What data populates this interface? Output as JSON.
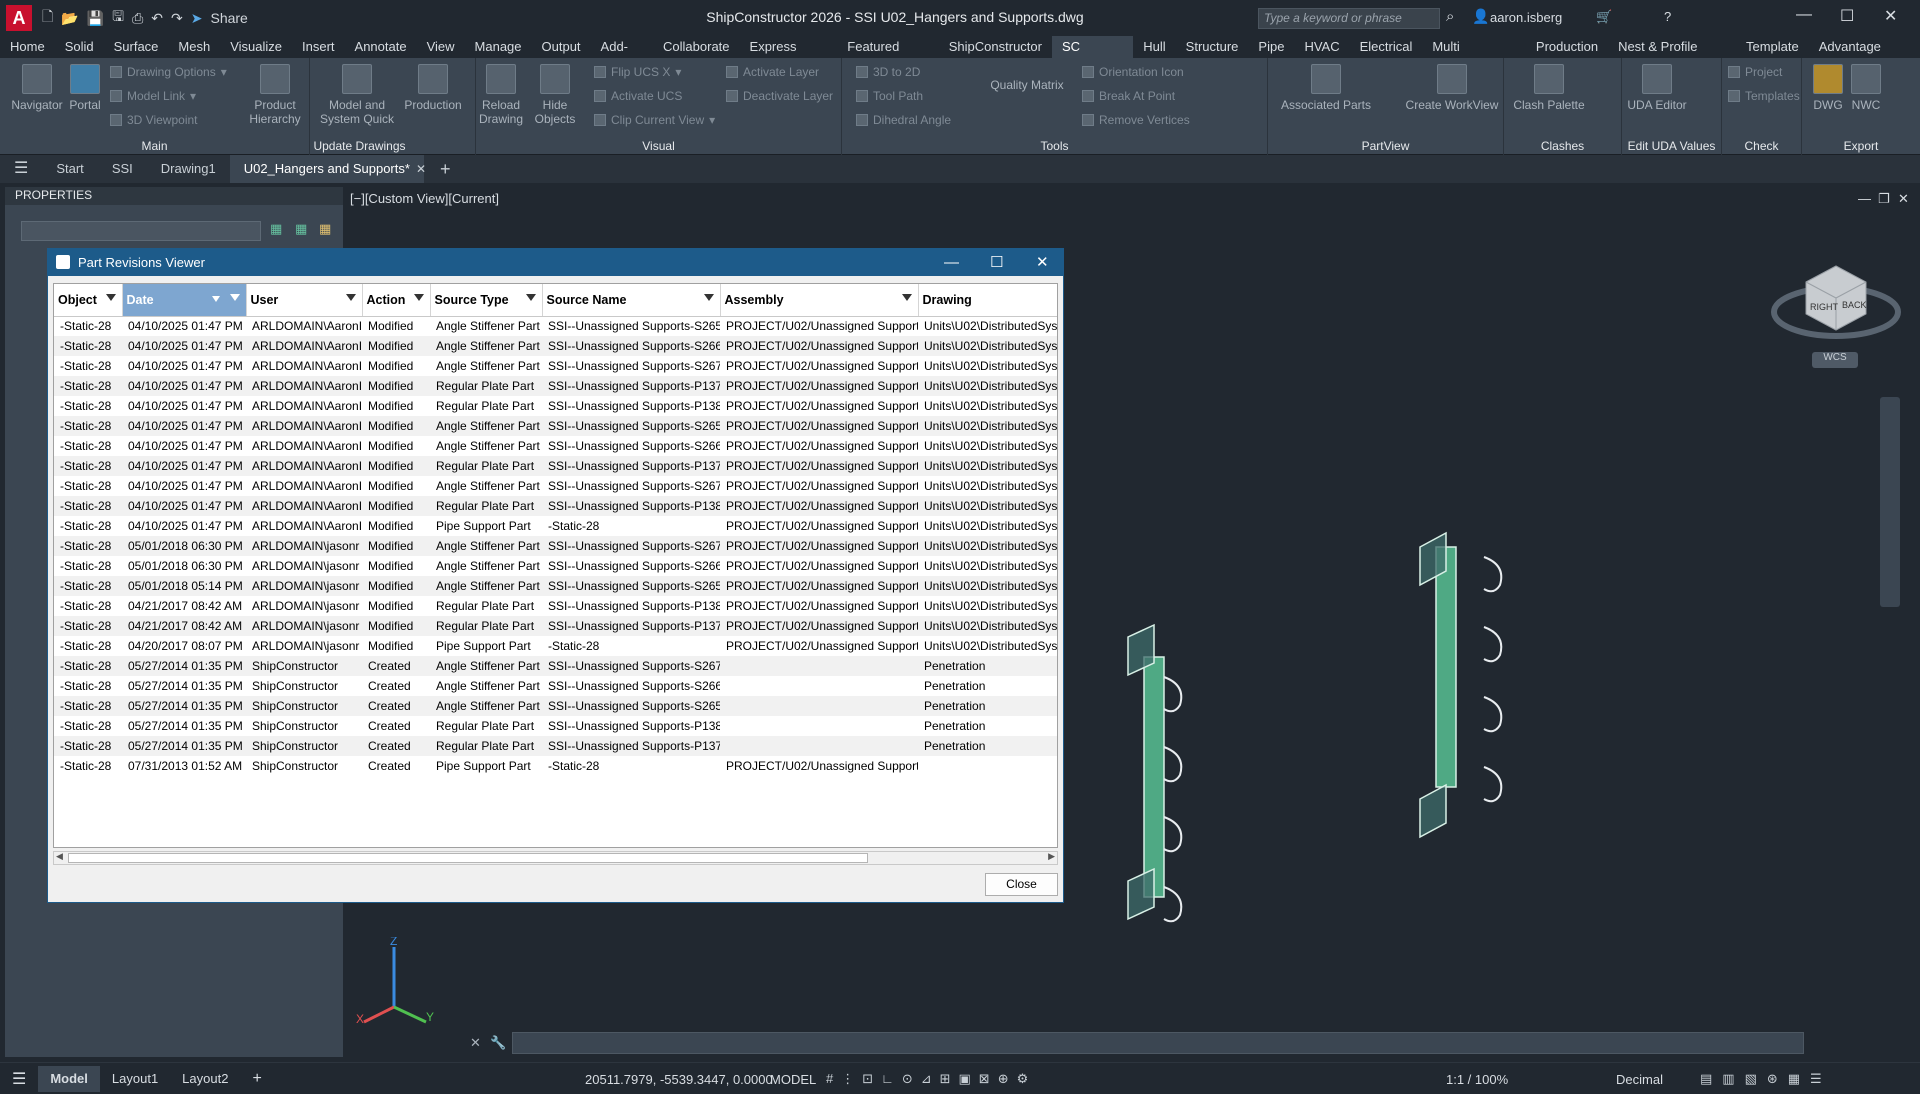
{
  "titlebar": {
    "title": "ShipConstructor 2026 - SSI   U02_Hangers and Supports.dwg",
    "share_label": "Share",
    "search_placeholder": "Type a keyword or phrase",
    "user": "aaron.isberg"
  },
  "ribbon_tabs": [
    "Home",
    "Solid",
    "Surface",
    "Mesh",
    "Visualize",
    "Insert",
    "Annotate",
    "View",
    "Manage",
    "Output",
    "Add-ins",
    "Collaborate",
    "Express Tools",
    "Featured Apps",
    "ShipConstructor",
    "SC Utilities",
    "Hull",
    "Structure",
    "Pipe",
    "HVAC",
    "Electrical",
    "Multi Discipline",
    "Production",
    "Nest & Profile Plots",
    "Template",
    "Advantage Pack"
  ],
  "active_ribbon_tab": "SC Utilities",
  "ribbon": {
    "main": {
      "title": "Main",
      "navigator": "Navigator",
      "portal": "Portal",
      "drawing_options": "Drawing Options",
      "model_link": "Model Link",
      "viewpoint": "3D Viewpoint"
    },
    "update": {
      "title": "Update Drawings",
      "product_hierarchy": "Product Hierarchy",
      "model_system": "Model and System Quick",
      "production": "Production"
    },
    "visual": {
      "title": "Visual",
      "reload": "Reload Drawing",
      "hide": "Hide Objects",
      "flip": "Flip UCS X",
      "activate_ucs": "Activate UCS",
      "clip": "Clip Current View",
      "activate_layer": "Activate Layer",
      "deactivate_layer": "Deactivate Layer"
    },
    "tools": {
      "title": "Tools",
      "to2d": "3D to 2D",
      "toolpath": "Tool Path",
      "dihedral": "Dihedral Angle",
      "quality": "Quality Matrix",
      "orientation": "Orientation Icon",
      "break": "Break At Point",
      "remove": "Remove Vertices"
    },
    "partview": {
      "title": "PartView",
      "assoc": "Associated Parts",
      "workview": "Create WorkView"
    },
    "clashes": {
      "title": "Clashes",
      "palette": "Clash Palette"
    },
    "uda": {
      "title": "Edit UDA Values",
      "editor": "UDA Editor"
    },
    "check": {
      "title": "Check",
      "project": "Project",
      "templates": "Templates"
    },
    "export": {
      "title": "Export",
      "dwg": "DWG",
      "nwc": "NWC"
    }
  },
  "file_tabs": [
    "Start",
    "SSI",
    "Drawing1",
    "U02_Hangers and Supports*"
  ],
  "properties": {
    "title": "PROPERTIES"
  },
  "viewport": {
    "label": "[−][Custom View][Current]",
    "wcs": "WCS",
    "cube_right": "RIGHT",
    "cube_back": "BACK"
  },
  "dialog": {
    "title": "Part Revisions Viewer",
    "close_label": "Close",
    "columns": [
      "Object",
      "Date",
      "User",
      "Action",
      "Source Type",
      "Source Name",
      "Assembly",
      "Drawing"
    ],
    "rows": [
      [
        "-Static-28",
        "04/10/2025 01:47 PM",
        "ARLDOMAIN\\AaronI",
        "Modified",
        "Angle Stiffener Part",
        "SSI--Unassigned Supports-S265",
        "PROJECT/U02/Unassigned Supports",
        "Units\\U02\\DistributedSyst"
      ],
      [
        "-Static-28",
        "04/10/2025 01:47 PM",
        "ARLDOMAIN\\AaronI",
        "Modified",
        "Angle Stiffener Part",
        "SSI--Unassigned Supports-S266",
        "PROJECT/U02/Unassigned Supports",
        "Units\\U02\\DistributedSyst"
      ],
      [
        "-Static-28",
        "04/10/2025 01:47 PM",
        "ARLDOMAIN\\AaronI",
        "Modified",
        "Angle Stiffener Part",
        "SSI--Unassigned Supports-S267",
        "PROJECT/U02/Unassigned Supports",
        "Units\\U02\\DistributedSyst"
      ],
      [
        "-Static-28",
        "04/10/2025 01:47 PM",
        "ARLDOMAIN\\AaronI",
        "Modified",
        "Regular Plate Part",
        "SSI--Unassigned Supports-P137",
        "PROJECT/U02/Unassigned Supports",
        "Units\\U02\\DistributedSyst"
      ],
      [
        "-Static-28",
        "04/10/2025 01:47 PM",
        "ARLDOMAIN\\AaronI",
        "Modified",
        "Regular Plate Part",
        "SSI--Unassigned Supports-P138",
        "PROJECT/U02/Unassigned Supports",
        "Units\\U02\\DistributedSyst"
      ],
      [
        "-Static-28",
        "04/10/2025 01:47 PM",
        "ARLDOMAIN\\AaronI",
        "Modified",
        "Angle Stiffener Part",
        "SSI--Unassigned Supports-S265",
        "PROJECT/U02/Unassigned Supports",
        "Units\\U02\\DistributedSyst"
      ],
      [
        "-Static-28",
        "04/10/2025 01:47 PM",
        "ARLDOMAIN\\AaronI",
        "Modified",
        "Angle Stiffener Part",
        "SSI--Unassigned Supports-S266",
        "PROJECT/U02/Unassigned Supports",
        "Units\\U02\\DistributedSyst"
      ],
      [
        "-Static-28",
        "04/10/2025 01:47 PM",
        "ARLDOMAIN\\AaronI",
        "Modified",
        "Regular Plate Part",
        "SSI--Unassigned Supports-P137",
        "PROJECT/U02/Unassigned Supports",
        "Units\\U02\\DistributedSyst"
      ],
      [
        "-Static-28",
        "04/10/2025 01:47 PM",
        "ARLDOMAIN\\AaronI",
        "Modified",
        "Angle Stiffener Part",
        "SSI--Unassigned Supports-S267",
        "PROJECT/U02/Unassigned Supports",
        "Units\\U02\\DistributedSyst"
      ],
      [
        "-Static-28",
        "04/10/2025 01:47 PM",
        "ARLDOMAIN\\AaronI",
        "Modified",
        "Regular Plate Part",
        "SSI--Unassigned Supports-P138",
        "PROJECT/U02/Unassigned Supports",
        "Units\\U02\\DistributedSyst"
      ],
      [
        "-Static-28",
        "04/10/2025 01:47 PM",
        "ARLDOMAIN\\AaronI",
        "Modified",
        "Pipe Support Part",
        "-Static-28",
        "PROJECT/U02/Unassigned Supports",
        "Units\\U02\\DistributedSyst"
      ],
      [
        "-Static-28",
        "05/01/2018 06:30 PM",
        "ARLDOMAIN\\jasonr",
        "Modified",
        "Angle Stiffener Part",
        "SSI--Unassigned Supports-S267",
        "PROJECT/U02/Unassigned Supports",
        "Units\\U02\\DistributedSyst"
      ],
      [
        "-Static-28",
        "05/01/2018 06:30 PM",
        "ARLDOMAIN\\jasonr",
        "Modified",
        "Angle Stiffener Part",
        "SSI--Unassigned Supports-S266",
        "PROJECT/U02/Unassigned Supports",
        "Units\\U02\\DistributedSyst"
      ],
      [
        "-Static-28",
        "05/01/2018 05:14 PM",
        "ARLDOMAIN\\jasonr",
        "Modified",
        "Angle Stiffener Part",
        "SSI--Unassigned Supports-S265",
        "PROJECT/U02/Unassigned Supports",
        "Units\\U02\\DistributedSyst"
      ],
      [
        "-Static-28",
        "04/21/2017 08:42 AM",
        "ARLDOMAIN\\jasonr",
        "Modified",
        "Regular Plate Part",
        "SSI--Unassigned Supports-P138",
        "PROJECT/U02/Unassigned Supports",
        "Units\\U02\\DistributedSyst"
      ],
      [
        "-Static-28",
        "04/21/2017 08:42 AM",
        "ARLDOMAIN\\jasonr",
        "Modified",
        "Regular Plate Part",
        "SSI--Unassigned Supports-P137",
        "PROJECT/U02/Unassigned Supports",
        "Units\\U02\\DistributedSyst"
      ],
      [
        "-Static-28",
        "04/20/2017 08:07 PM",
        "ARLDOMAIN\\jasonr",
        "Modified",
        "Pipe Support Part",
        "-Static-28",
        "PROJECT/U02/Unassigned Supports",
        "Units\\U02\\DistributedSyst"
      ],
      [
        "-Static-28",
        "05/27/2014 01:35 PM",
        "ShipConstructor",
        "Created",
        "Angle Stiffener Part",
        "SSI--Unassigned Supports-S267",
        "",
        "Penetration"
      ],
      [
        "-Static-28",
        "05/27/2014 01:35 PM",
        "ShipConstructor",
        "Created",
        "Angle Stiffener Part",
        "SSI--Unassigned Supports-S266",
        "",
        "Penetration"
      ],
      [
        "-Static-28",
        "05/27/2014 01:35 PM",
        "ShipConstructor",
        "Created",
        "Angle Stiffener Part",
        "SSI--Unassigned Supports-S265",
        "",
        "Penetration"
      ],
      [
        "-Static-28",
        "05/27/2014 01:35 PM",
        "ShipConstructor",
        "Created",
        "Regular Plate Part",
        "SSI--Unassigned Supports-P138",
        "",
        "Penetration"
      ],
      [
        "-Static-28",
        "05/27/2014 01:35 PM",
        "ShipConstructor",
        "Created",
        "Regular Plate Part",
        "SSI--Unassigned Supports-P137",
        "",
        "Penetration"
      ],
      [
        "-Static-28",
        "07/31/2013 01:52 AM",
        "ShipConstructor",
        "Created",
        "Pipe Support Part",
        "-Static-28",
        "PROJECT/U02/Unassigned Supports",
        ""
      ]
    ]
  },
  "statusbar": {
    "tabs": [
      "Model",
      "Layout1",
      "Layout2"
    ],
    "coords": "20511.7979, -5539.3447, 0.0000",
    "model": "MODEL",
    "scale": "1:1 / 100%",
    "units": "Decimal"
  },
  "colors": {
    "accent": "#1d5b8a",
    "ribbon": "#3b4652",
    "background": "#212830",
    "model_green": "#5fd4a0"
  }
}
